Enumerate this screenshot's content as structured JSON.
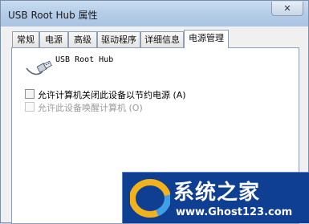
{
  "window": {
    "title": "USB Root Hub 属性",
    "close_glyph": "✕"
  },
  "tabs": [
    {
      "label": "常规"
    },
    {
      "label": "电源"
    },
    {
      "label": "高级"
    },
    {
      "label": "驱动程序"
    },
    {
      "label": "详细信息"
    },
    {
      "label": "电源管理",
      "active": true
    }
  ],
  "device": {
    "icon": "usb-plug-icon",
    "name": "USB Root Hub"
  },
  "options": [
    {
      "label": "允许计算机关闭此设备以节约电源 (A)",
      "checked": false,
      "enabled": true
    },
    {
      "label": "允许此设备唤醒计算机 (O)",
      "checked": false,
      "enabled": false
    }
  ],
  "watermark": {
    "text_cn": "系统之家",
    "url": "www.Ghost123.com",
    "logo_icon": "ghost-logo-icon",
    "colors": {
      "bg": "#0f3f93",
      "ring_gold": "#f2b21c",
      "ring_blue": "#3ea0e8"
    }
  }
}
